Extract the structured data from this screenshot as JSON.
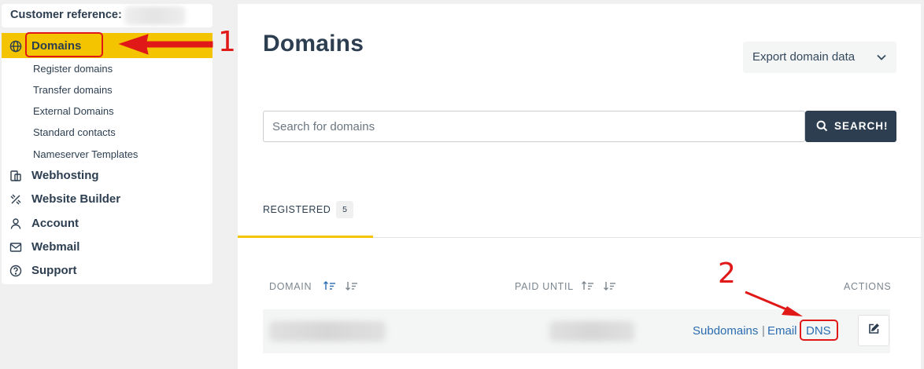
{
  "customer_reference": {
    "label": "Customer reference:"
  },
  "sidebar": {
    "items": [
      {
        "label": "Domains",
        "icon": "globe-icon"
      },
      {
        "label": "Webhosting",
        "icon": "hosting-icon"
      },
      {
        "label": "Website Builder",
        "icon": "website-builder-icon"
      },
      {
        "label": "Account",
        "icon": "user-icon"
      },
      {
        "label": "Webmail",
        "icon": "mail-icon"
      },
      {
        "label": "Support",
        "icon": "help-icon"
      }
    ],
    "domain_subitems": [
      "Register domains",
      "Transfer domains",
      "External Domains",
      "Standard contacts",
      "Nameserver Templates"
    ]
  },
  "main": {
    "title": "Domains",
    "export_label": "Export domain data",
    "search_placeholder": "Search for domains",
    "search_button": "SEARCH!",
    "tab": {
      "label": "REGISTERED",
      "count": "5"
    },
    "table": {
      "headers": {
        "domain": "DOMAIN",
        "paid_until": "PAID UNTIL",
        "actions": "ACTIONS"
      },
      "row_links": {
        "subdomains": "Subdomains",
        "separator": "|",
        "email": "Email",
        "dns": "DNS"
      }
    }
  },
  "annotations": {
    "first": "1",
    "second": "2"
  },
  "colors": {
    "accent": "#f5c400",
    "dark": "#2c3e50",
    "link": "#2a6db0",
    "annotation": "#e01818"
  }
}
